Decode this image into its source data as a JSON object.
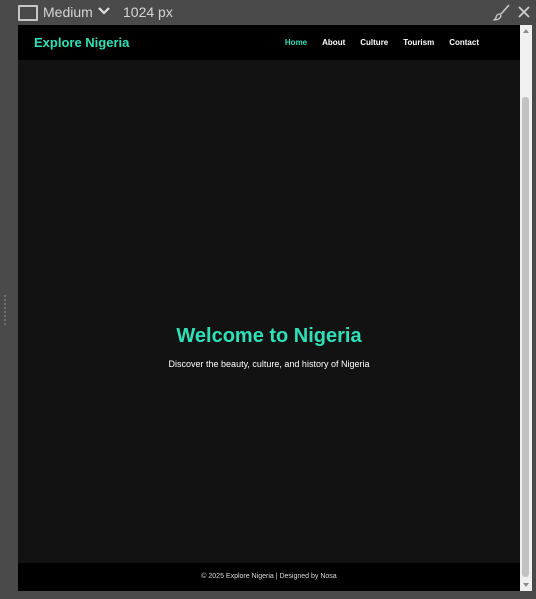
{
  "toolbar": {
    "device_label": "Medium",
    "width_label": "1024 px",
    "device_icon": "monitor-icon",
    "dropdown_icon": "chevron-down-icon",
    "brush_icon": "brush-icon",
    "close_icon": "close-icon"
  },
  "site": {
    "brand": "Explore Nigeria",
    "nav": [
      "Home",
      "About",
      "Culture",
      "Tourism",
      "Contact"
    ],
    "active_nav": "Home",
    "hero": {
      "title": "Welcome to Nigeria",
      "subtitle": "Discover the beauty, culture, and history of Nigeria"
    },
    "footer": "© 2025 Explore Nigeria | Designed by Nosa"
  },
  "colors": {
    "accent": "#2ee0b8",
    "page_bg": "#121212",
    "nav_bg": "#000000",
    "chrome_bg": "#4a4a4a"
  }
}
